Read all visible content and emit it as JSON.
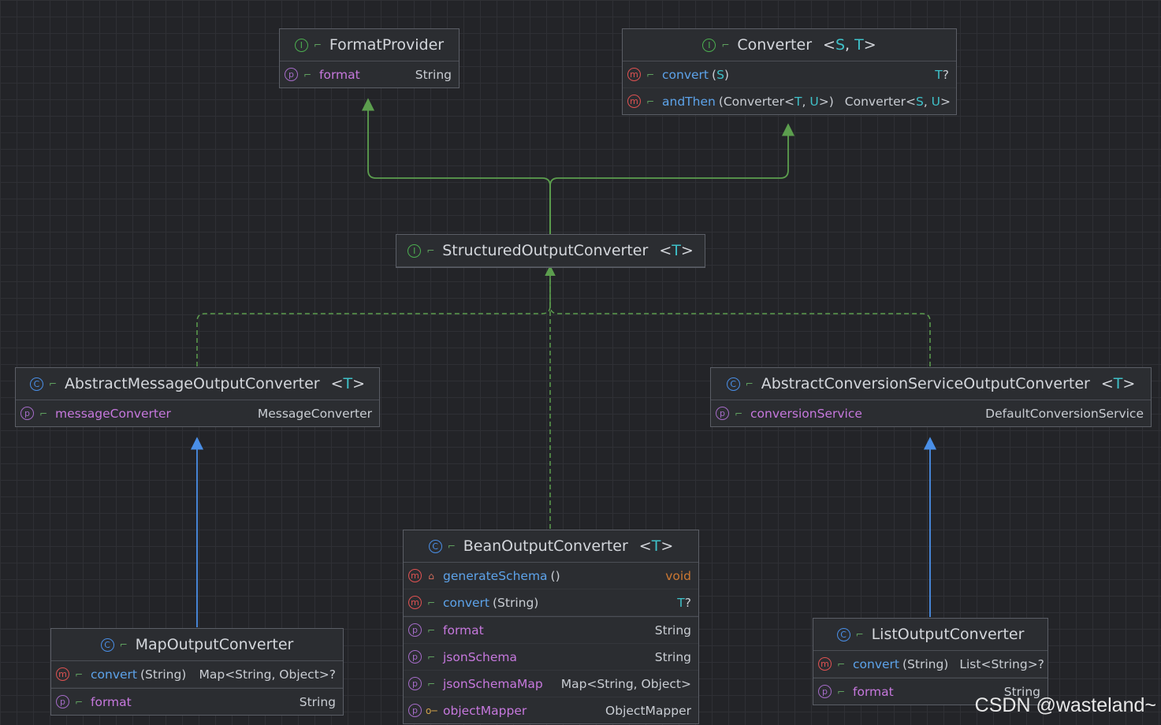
{
  "nodes": {
    "format_provider": {
      "kind": "I",
      "name": "FormatProvider",
      "generic": "",
      "members": [
        {
          "kind": "p",
          "name": "format",
          "args": "",
          "type": "String"
        }
      ]
    },
    "converter": {
      "kind": "I",
      "name": "Converter",
      "generic": "<S, T>",
      "members": [
        {
          "kind": "m",
          "name": "convert",
          "args": "(S)",
          "type": "T?"
        },
        {
          "kind": "m",
          "name": "andThen",
          "args": "(Converter<T, U>)",
          "type": "Converter<S, U>"
        }
      ]
    },
    "structured": {
      "kind": "I",
      "name": "StructuredOutputConverter",
      "generic": "<T>",
      "members": []
    },
    "abstract_message": {
      "kind": "C",
      "name": "AbstractMessageOutputConverter",
      "generic": "<T>",
      "members": [
        {
          "kind": "p",
          "name": "messageConverter",
          "args": "",
          "type": "MessageConverter"
        }
      ]
    },
    "abstract_conversion": {
      "kind": "C",
      "name": "AbstractConversionServiceOutputConverter",
      "generic": "<T>",
      "members": [
        {
          "kind": "p",
          "name": "conversionService",
          "args": "",
          "type": "DefaultConversionService"
        }
      ]
    },
    "bean": {
      "kind": "C",
      "name": "BeanOutputConverter",
      "generic": "<T>",
      "members": [
        {
          "kind": "m",
          "name": "generateSchema",
          "args": "()",
          "type": "void"
        },
        {
          "kind": "m",
          "name": "convert",
          "args": "(String)",
          "type": "T?"
        },
        {
          "kind": "p",
          "name": "format",
          "args": "",
          "type": "String"
        },
        {
          "kind": "p",
          "name": "jsonSchema",
          "args": "",
          "type": "String"
        },
        {
          "kind": "p",
          "name": "jsonSchemaMap",
          "args": "",
          "type": "Map<String, Object>"
        },
        {
          "kind": "p",
          "name": "objectMapper",
          "args": "",
          "type": "ObjectMapper"
        }
      ]
    },
    "map": {
      "kind": "C",
      "name": "MapOutputConverter",
      "generic": "",
      "members": [
        {
          "kind": "m",
          "name": "convert",
          "args": "(String)",
          "type": "Map<String, Object>?"
        },
        {
          "kind": "p",
          "name": "format",
          "args": "",
          "type": "String"
        }
      ]
    },
    "list": {
      "kind": "C",
      "name": "ListOutputConverter",
      "generic": "",
      "members": [
        {
          "kind": "m",
          "name": "convert",
          "args": "(String)",
          "type": "List<String>?"
        },
        {
          "kind": "p",
          "name": "format",
          "args": "",
          "type": "String"
        }
      ]
    }
  },
  "edges": [
    {
      "from": "structured",
      "to": "format_provider",
      "style": "extends"
    },
    {
      "from": "structured",
      "to": "converter",
      "style": "extends"
    },
    {
      "from": "abstract_message",
      "to": "structured",
      "style": "implements"
    },
    {
      "from": "abstract_conversion",
      "to": "structured",
      "style": "implements"
    },
    {
      "from": "bean",
      "to": "structured",
      "style": "implements"
    },
    {
      "from": "map",
      "to": "abstract_message",
      "style": "extends-class"
    },
    {
      "from": "list",
      "to": "abstract_conversion",
      "style": "extends-class"
    }
  ],
  "colors": {
    "interface_edge": "#5c9e4e",
    "class_edge": "#4a8fe7",
    "method_name": "#5da3ea",
    "property_name": "#c678dd",
    "type_variable": "#3fc1c9"
  },
  "watermark": "CSDN @wasteland~"
}
